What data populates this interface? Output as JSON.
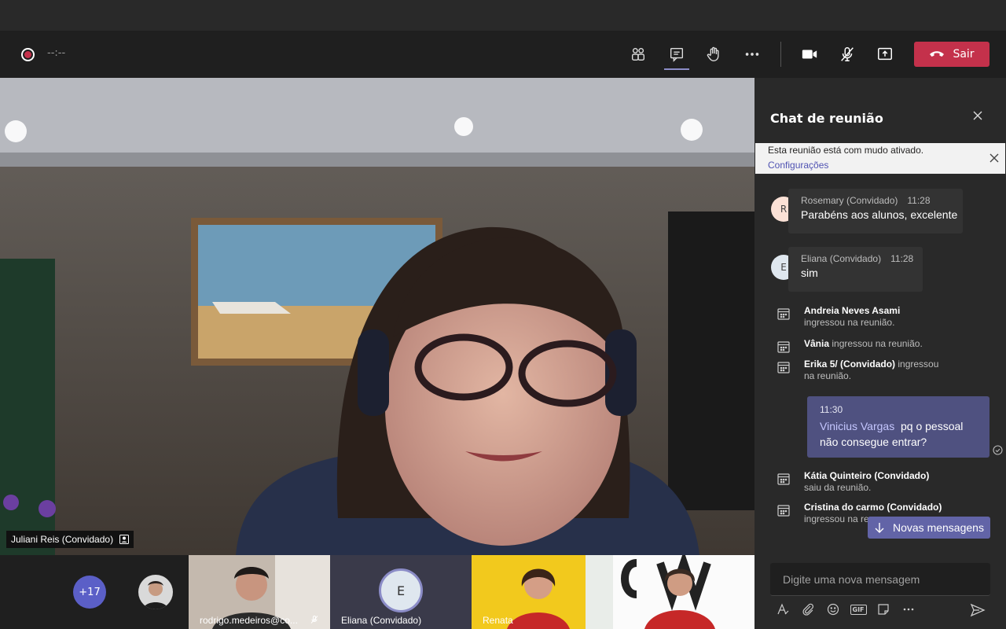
{
  "toolbar": {
    "timer": "--:--",
    "leave_label": "Sair",
    "leave_color": "#c4314b",
    "icons": [
      "participants-icon",
      "chat-icon",
      "raise-hand-icon",
      "more-icon",
      "camera-icon",
      "mic-off-icon",
      "share-screen-icon"
    ]
  },
  "stage": {
    "speaker_name": "Juliani Reis (Convidado)"
  },
  "strip": {
    "more_count": "+17",
    "tiles": [
      {
        "label": "rodrigo.medeiros@co..."
      },
      {
        "label": "Eliana (Convidado)",
        "initial": "E"
      },
      {
        "label": "Renata"
      },
      {
        "label": ""
      }
    ]
  },
  "chat": {
    "title": "Chat de reunião",
    "banner_text": "Esta reunião está com mudo ativado.",
    "banner_link": "Configurações",
    "messages": [
      {
        "initial": "R",
        "author": "Rosemary (Convidado)",
        "time": "11:28",
        "text": "Parabéns aos alunos, excelente"
      },
      {
        "initial": "E",
        "author": "Eliana (Convidado)",
        "time": "11:28",
        "text": "sim"
      }
    ],
    "events": [
      {
        "who": "Andreia Neves Asami",
        "action": "ingressou na reunião."
      },
      {
        "who": "Vânia",
        "action": "ingressou na reunião."
      },
      {
        "who": "Erika 5/ (Convidado)",
        "action": "ingressou na reunião."
      },
      {
        "who": "Kátia Quinteiro (Convidado)",
        "action": "saiu da reunião."
      },
      {
        "who": "Cristina do carmo (Convidado)",
        "action": "ingressou na re"
      }
    ],
    "own_message": {
      "time": "11:30",
      "mention": "Vinicius Vargas",
      "text": "pq o pessoal não consegue entrar?"
    },
    "new_messages_label": "Novas mensagens",
    "compose_placeholder": "Digite uma nova mensagem",
    "accent": "#6264a7"
  }
}
